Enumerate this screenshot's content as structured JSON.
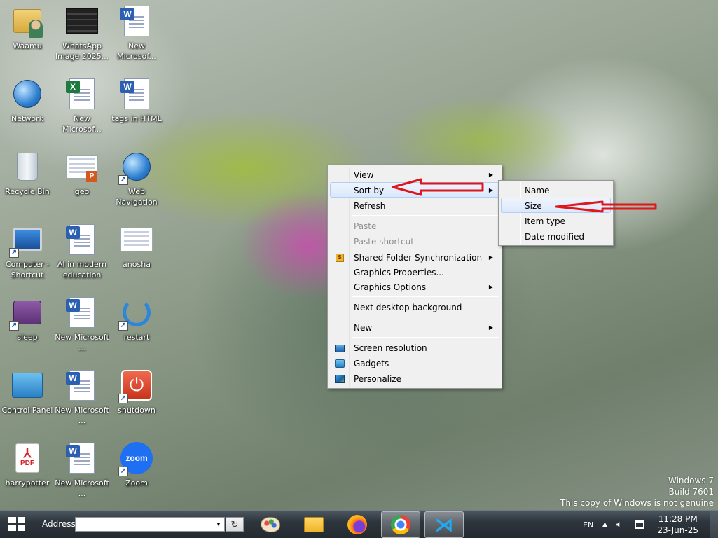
{
  "desktop": {
    "icons": [
      {
        "label": "Waamu",
        "icon": "folder-user-icon"
      },
      {
        "label": "WhatsApp Image 2025...",
        "icon": "image-file-icon"
      },
      {
        "label": "New Microsof...",
        "icon": "word-document-icon"
      },
      {
        "label": "Network",
        "icon": "network-globe-icon"
      },
      {
        "label": "New Microsof...",
        "icon": "excel-document-icon"
      },
      {
        "label": "tags in HTML",
        "icon": "word-document-icon"
      },
      {
        "label": "Recycle Bin",
        "icon": "recycle-bin-icon"
      },
      {
        "label": "geo",
        "icon": "powerpoint-document-icon"
      },
      {
        "label": "Web Navigation",
        "icon": "web-globe-icon"
      },
      {
        "label": "Computer - Shortcut",
        "icon": "computer-icon"
      },
      {
        "label": "AI in modern education",
        "icon": "word-document-icon"
      },
      {
        "label": "anosha",
        "icon": "image-file-icon"
      },
      {
        "label": "sleep",
        "icon": "sleep-icon"
      },
      {
        "label": "New Microsoft ...",
        "icon": "word-document-icon"
      },
      {
        "label": "restart",
        "icon": "restart-icon"
      },
      {
        "label": "Control Panel",
        "icon": "control-panel-icon"
      },
      {
        "label": "New Microsoft ...",
        "icon": "word-document-icon"
      },
      {
        "label": "shutdown",
        "icon": "power-icon"
      },
      {
        "label": "harrypotter",
        "icon": "pdf-icon"
      },
      {
        "label": "New Microsoft ...",
        "icon": "word-document-icon"
      },
      {
        "label": "Zoom",
        "icon": "zoom-icon"
      }
    ]
  },
  "context_menu": {
    "items": [
      {
        "label": "View",
        "has_submenu": true
      },
      {
        "label": "Sort by",
        "has_submenu": true,
        "highlighted": true
      },
      {
        "label": "Refresh"
      },
      {
        "label": "Paste",
        "disabled": true
      },
      {
        "label": "Paste shortcut",
        "disabled": true
      },
      {
        "label": "Shared Folder Synchronization",
        "has_submenu": true,
        "icon": "sync-folder-icon"
      },
      {
        "label": "Graphics Properties..."
      },
      {
        "label": "Graphics Options",
        "has_submenu": true
      },
      {
        "label": "Next desktop background"
      },
      {
        "label": "New",
        "has_submenu": true
      },
      {
        "label": "Screen resolution",
        "icon": "screen-resolution-icon"
      },
      {
        "label": "Gadgets",
        "icon": "gadgets-icon"
      },
      {
        "label": "Personalize",
        "icon": "personalize-icon"
      }
    ]
  },
  "sort_submenu": {
    "items": [
      {
        "label": "Name"
      },
      {
        "label": "Size",
        "highlighted": true
      },
      {
        "label": "Item type"
      },
      {
        "label": "Date modified"
      }
    ]
  },
  "watermark": {
    "line1": "Windows 7",
    "line2": "Build 7601",
    "line3": "This copy of Windows is not genuine"
  },
  "taskbar": {
    "address_label": "Address",
    "address_value": "",
    "apps": [
      {
        "name": "paint-palette-icon"
      },
      {
        "name": "file-explorer-icon"
      },
      {
        "name": "firefox-icon"
      },
      {
        "name": "chrome-icon",
        "active": true
      },
      {
        "name": "vscode-icon",
        "active": true
      }
    ],
    "language": "EN",
    "clock_time": "11:28 PM",
    "clock_date": "23-Jun-25"
  },
  "colors": {
    "annotation_arrow": "#e0161b",
    "menu_highlight": "#dbe8fb"
  }
}
